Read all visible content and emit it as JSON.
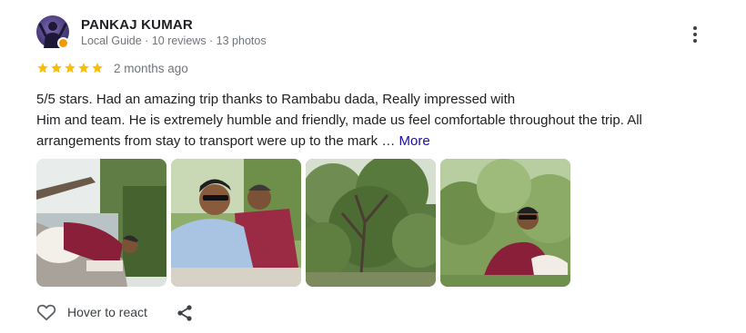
{
  "reviewer": {
    "name": "PANKAJ KUMAR",
    "meta": "Local Guide · 10 reviews · 13 photos"
  },
  "rating": {
    "stars": 5,
    "max": 5,
    "color": "#fbbc04"
  },
  "date": "2 months ago",
  "review": {
    "line1": "5/5 stars. Had an amazing trip thanks to Rambabu dada, Really impressed with",
    "line2": "Him and team. He is extremely humble and friendly, made us feel comfortable throughout the trip. All",
    "line3": "arrangements from stay to transport were up to the mark … ",
    "more_label": "More"
  },
  "photos": [
    {
      "icon": "photo-thumbnail"
    },
    {
      "icon": "photo-thumbnail"
    },
    {
      "icon": "photo-thumbnail"
    },
    {
      "icon": "photo-thumbnail"
    }
  ],
  "actions": {
    "react_label": "Hover to react",
    "react_icon": "heart-outline-icon",
    "share_icon": "share-icon",
    "menu_icon": "more-vert-icon"
  },
  "colors": {
    "link": "#1a0dab",
    "secondary_text": "#70757a",
    "badge": "#f29900"
  }
}
